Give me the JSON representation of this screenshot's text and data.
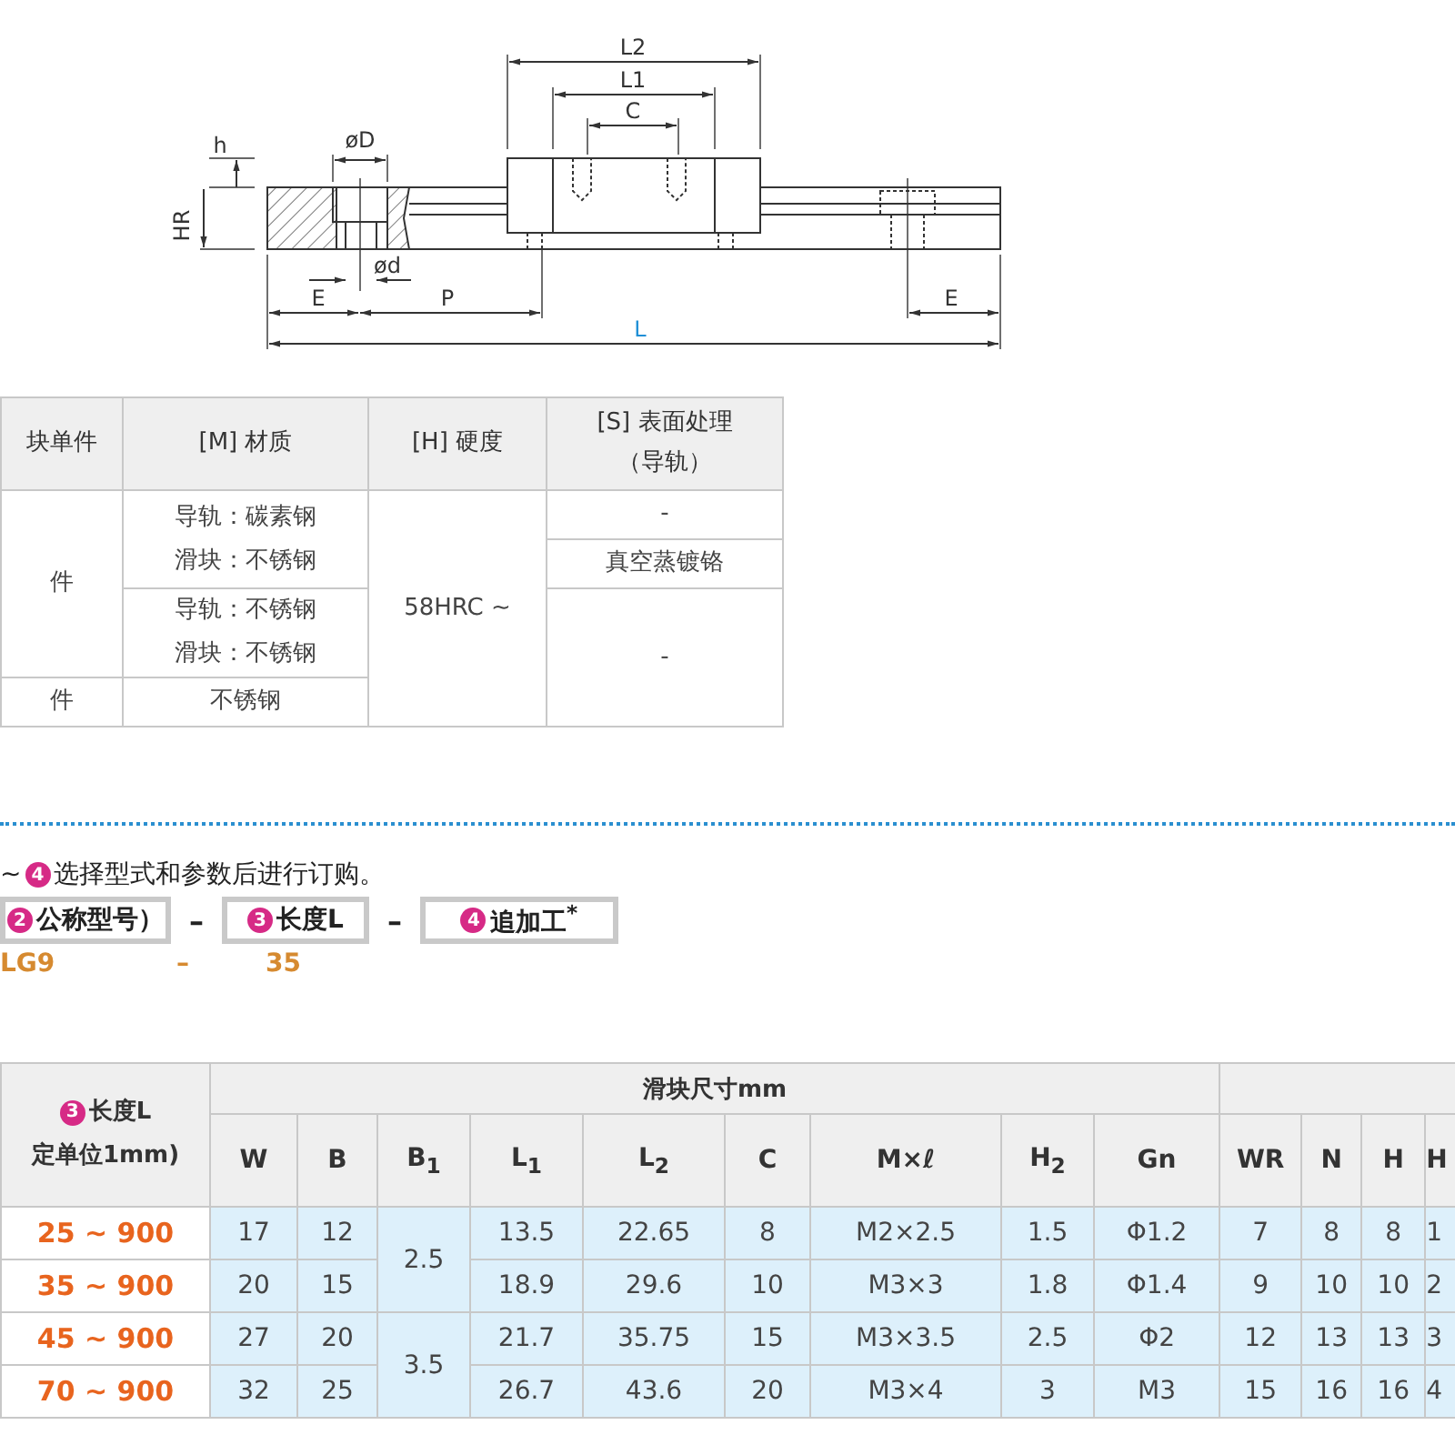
{
  "drawing": {
    "labels": [
      {
        "text": "L2"
      },
      {
        "text": "L1"
      },
      {
        "text": "C"
      },
      {
        "text": "øD"
      },
      {
        "text": "h"
      },
      {
        "text": "HR"
      },
      {
        "text": "ød"
      },
      {
        "text": "E"
      },
      {
        "text": "P"
      },
      {
        "text": "E"
      },
      {
        "text": "L",
        "kind": "accent"
      }
    ]
  },
  "spec_table": {
    "headers": [
      [
        "块单件"
      ],
      [
        "[M] 材质"
      ],
      [
        "[H] 硬度"
      ],
      [
        "[S] 表面处理",
        "（导轨）"
      ]
    ],
    "rows": [
      [
        {
          "lines": [
            "件"
          ],
          "rowspan": 3
        },
        {
          "lines": [
            "导轨：碳素钢",
            "滑块：不锈钢"
          ],
          "rowspan": 2
        },
        {
          "lines": [
            "58HRC ~"
          ],
          "rowspan": 4
        },
        {
          "lines": [
            "-"
          ]
        }
      ],
      [
        {
          "lines": [
            "真空蒸镀铬"
          ]
        }
      ],
      [
        {
          "lines": [
            "导轨：不锈钢",
            "滑块：不锈钢"
          ]
        },
        {
          "lines": [
            "-"
          ],
          "rowspan": 2
        }
      ],
      [
        {
          "lines": [
            "件"
          ]
        },
        {
          "lines": [
            "不锈钢"
          ]
        }
      ]
    ]
  },
  "order": {
    "intro": [
      {
        "kind": "text",
        "text": "~"
      },
      {
        "kind": "badge",
        "text": "4"
      },
      {
        "kind": "text",
        "text": "选择型式和参数后进行订购。"
      }
    ],
    "fields": [
      {
        "badge": "2",
        "label": "公称型号）"
      },
      {
        "badge": "3",
        "label": "长度L"
      },
      {
        "badge": "4",
        "label": "追加工$^{*}$"
      }
    ],
    "separator": "–",
    "values": [
      "LG9",
      "–",
      "35"
    ]
  },
  "dim_table": {
    "length_header": {
      "badge": "3",
      "label": "长度L",
      "note": "定单位1mm)"
    },
    "groups": [
      "滑块尺寸mm"
    ],
    "columns": [
      "W",
      "B",
      "B$_{1}$",
      "L$_{1}$",
      "L$_{2}$",
      "C",
      "M×ℓ",
      "H$_{2}$",
      "Gn",
      "WR",
      "N",
      "H",
      "H"
    ],
    "rows": [
      {
        "length": "25 ~ 900",
        "cells": [
          {
            "text": "17"
          },
          {
            "text": "12"
          },
          {
            "text": "2.5",
            "rowspan": 2
          },
          {
            "text": "13.5"
          },
          {
            "text": "22.65"
          },
          {
            "text": "8"
          },
          {
            "text": "M2×2.5"
          },
          {
            "text": "1.5"
          },
          {
            "text": "Φ1.2"
          },
          {
            "text": "7"
          },
          {
            "text": "8"
          },
          {
            "text": "8"
          },
          {
            "text": "1"
          }
        ]
      },
      {
        "length": "35 ~ 900",
        "cells": [
          {
            "text": "20"
          },
          {
            "text": "15"
          },
          {
            "text": "18.9"
          },
          {
            "text": "29.6"
          },
          {
            "text": "10"
          },
          {
            "text": "M3×3"
          },
          {
            "text": "1.8"
          },
          {
            "text": "Φ1.4"
          },
          {
            "text": "9"
          },
          {
            "text": "10"
          },
          {
            "text": "10"
          },
          {
            "text": "2"
          }
        ]
      },
      {
        "length": "45 ~ 900",
        "cells": [
          {
            "text": "27"
          },
          {
            "text": "20"
          },
          {
            "text": "3.5",
            "rowspan": 2
          },
          {
            "text": "21.7"
          },
          {
            "text": "35.75"
          },
          {
            "text": "15"
          },
          {
            "text": "M3×3.5"
          },
          {
            "text": "2.5"
          },
          {
            "text": "Φ2"
          },
          {
            "text": "12"
          },
          {
            "text": "13"
          },
          {
            "text": "13"
          },
          {
            "text": "3"
          }
        ]
      },
      {
        "length": "70 ~ 900",
        "cells": [
          {
            "text": "32"
          },
          {
            "text": "25"
          },
          {
            "text": "26.7"
          },
          {
            "text": "43.6"
          },
          {
            "text": "20"
          },
          {
            "text": "M3×4"
          },
          {
            "text": "3"
          },
          {
            "text": "M3"
          },
          {
            "text": "15"
          },
          {
            "text": "16"
          },
          {
            "text": "16"
          },
          {
            "text": "4"
          }
        ]
      }
    ]
  }
}
